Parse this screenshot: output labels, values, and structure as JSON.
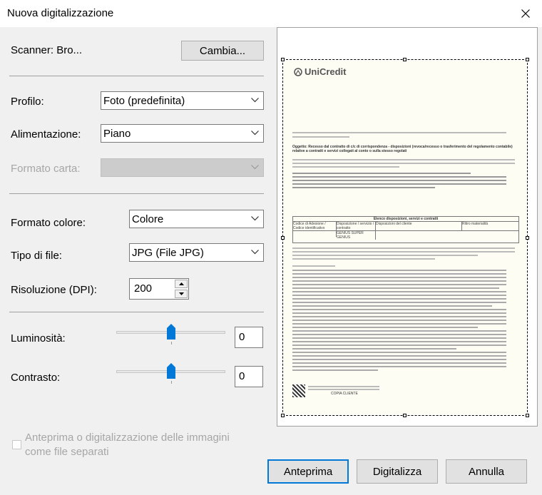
{
  "window": {
    "title": "Nuova digitalizzazione"
  },
  "scanner": {
    "label": "Scanner: Bro...",
    "change_button": "Cambia..."
  },
  "profile": {
    "label": "Profilo:",
    "value": "Foto (predefinita)"
  },
  "source": {
    "label": "Alimentazione:",
    "value": "Piano"
  },
  "paper_size": {
    "label": "Formato carta:",
    "value": ""
  },
  "color_format": {
    "label": "Formato colore:",
    "value": "Colore"
  },
  "file_type": {
    "label": "Tipo di file:",
    "value": "JPG (File JPG)"
  },
  "resolution": {
    "label": "Risoluzione (DPI):",
    "value": "200"
  },
  "brightness": {
    "label": "Luminosità:",
    "value": "0",
    "level": 0
  },
  "contrast": {
    "label": "Contrasto:",
    "value": "0",
    "level": 0
  },
  "separate_files": {
    "label_line1": "Anteprima o digitalizzazione delle immagini",
    "label_line2": "come file separati",
    "checked": false
  },
  "buttons": {
    "preview": "Anteprima",
    "scan": "Digitalizza",
    "cancel": "Annulla"
  },
  "preview_doc": {
    "logo": "UniCredit",
    "subject": "Oggetto: Recesso dal contratto di c/c di corrispondenza - disposizioni (revoca/recesso o trasferimento del regolamento contabile) relative a contratti e servizi collegati al conto o sulla stesso regolati",
    "table_title": "Elenco disposizioni, servizi e contratti",
    "col_code": "Codice di Adesione / Codice identificativo",
    "col_disp": "Disposizione / servizio / contratto",
    "col_client": "Disposizioni del cliente",
    "col_ritiro": "Ritiro materialità",
    "row_service": "GENIUS SUPER GENIUS",
    "footer": "COPIA CLIENTE"
  }
}
